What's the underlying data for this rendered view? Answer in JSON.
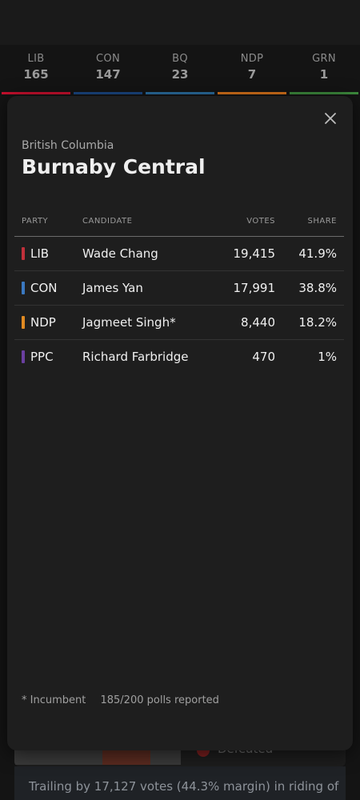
{
  "tally": [
    {
      "party": "LIB",
      "seats": "165",
      "color": "#c8102e"
    },
    {
      "party": "CON",
      "seats": "147",
      "color": "#1a4782"
    },
    {
      "party": "BQ",
      "seats": "23",
      "color": "#2a6ea0"
    },
    {
      "party": "NDP",
      "seats": "7",
      "color": "#d8731a"
    },
    {
      "party": "GRN",
      "seats": "1",
      "color": "#3d8b3d"
    }
  ],
  "background": {
    "defeated_label": "Defeated",
    "trailing_text": "Trailing by 17,127 votes (44.3% margin) in riding of"
  },
  "modal": {
    "province": "British Columbia",
    "riding": "Burnaby Central",
    "close_icon": "close-icon",
    "columns": {
      "party": "PARTY",
      "candidate": "CANDIDATE",
      "votes": "VOTES",
      "share": "SHARE"
    },
    "rows": [
      {
        "party": "LIB",
        "candidate": "Wade Chang",
        "votes": "19,415",
        "share": "41.9%",
        "color": "#c0303a"
      },
      {
        "party": "CON",
        "candidate": "James Yan",
        "votes": "17,991",
        "share": "38.8%",
        "color": "#3a78c0"
      },
      {
        "party": "NDP",
        "candidate": "Jagmeet Singh*",
        "votes": "8,440",
        "share": "18.2%",
        "color": "#e08a22"
      },
      {
        "party": "PPC",
        "candidate": "Richard Farbridge",
        "votes": "470",
        "share": "1%",
        "color": "#6a3fa0"
      }
    ],
    "footer": {
      "incumbent_note": "* Incumbent",
      "polls_reported": "185/200 polls reported"
    }
  }
}
